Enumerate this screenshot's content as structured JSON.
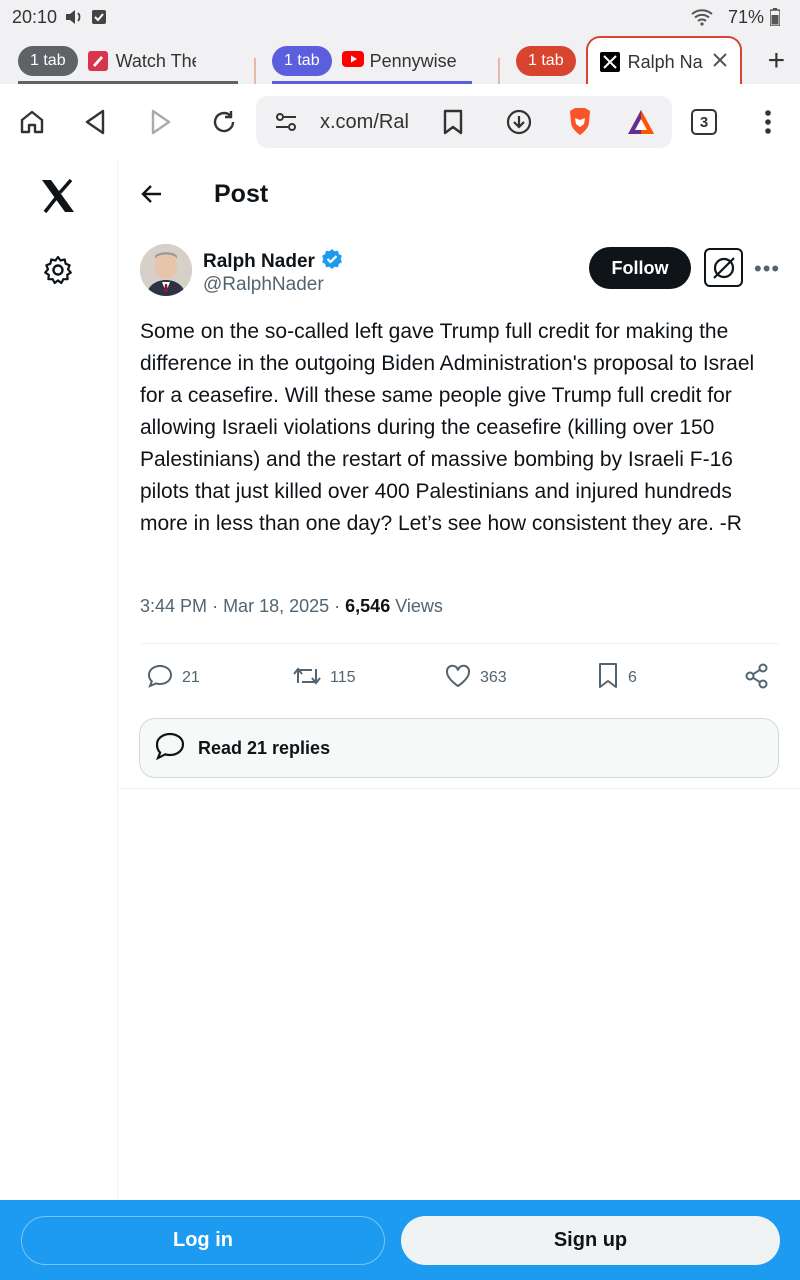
{
  "status_bar": {
    "time": "20:10",
    "battery": "71%"
  },
  "tabs": {
    "group1": {
      "count_label": "1 tab",
      "title": "Watch The L",
      "color": "#5f6368"
    },
    "group2": {
      "count_label": "1 tab",
      "title": "Pennywise -",
      "color": "#5b5fde"
    },
    "group3": {
      "count_label": "1 tab",
      "color": "#d9442e"
    },
    "active_tab": {
      "title": "Ralph Na"
    },
    "new_tab_label": "+"
  },
  "toolbar": {
    "url": "x.com/Ral",
    "tab_count": "3"
  },
  "post": {
    "header_title": "Post",
    "author_name": "Ralph Nader",
    "author_handle": "@RalphNader",
    "follow_label": "Follow",
    "more_label": "•••",
    "text": "Some on the so-called left gave Trump full credit for making the difference in the outgoing Biden Administration's proposal to Israel for a ceasefire. Will these same people give Trump full credit for allowing Israeli violations during the ceasefire (killing over 150 Palestinians) and the restart of massive bombing by Israeli F-16 pilots that just killed over 400 Palestinians and injured hundreds more in less than one day? Let’s see how consistent they are. -R",
    "time": "3:44 PM",
    "date": "Mar 18, 2025",
    "views_count": "6,546",
    "views_label": "Views",
    "replies": "21",
    "reposts": "115",
    "likes": "363",
    "bookmarks": "6",
    "read_replies_label": "Read 21 replies"
  },
  "bottom_bar": {
    "login_label": "Log in",
    "signup_label": "Sign up"
  },
  "colors": {
    "x_blue": "#1d9bf0",
    "verified": "#1d9bf0",
    "brave_orange": "#fb542b"
  }
}
